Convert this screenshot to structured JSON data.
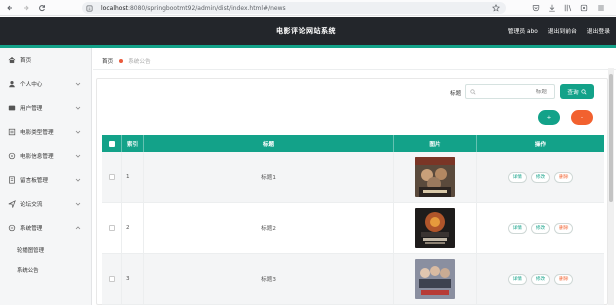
{
  "browser": {
    "url_host": "localhost",
    "url_path": ":8080/springbootmt92/admin/dist/index.html#/news"
  },
  "header": {
    "title": "电影评论网站系统",
    "user_label": "管理员 abo",
    "front_link": "退出到前台",
    "logout_link": "退出登录"
  },
  "sidebar": {
    "items": [
      {
        "label": "首页",
        "icon": "home-icon"
      },
      {
        "label": "个人中心",
        "icon": "user-icon"
      },
      {
        "label": "用户管理",
        "icon": "users-icon"
      },
      {
        "label": "电影类型管理",
        "icon": "category-icon"
      },
      {
        "label": "电影信息管理",
        "icon": "film-icon"
      },
      {
        "label": "留言板管理",
        "icon": "message-icon"
      },
      {
        "label": "论坛交流",
        "icon": "send-icon"
      },
      {
        "label": "系统管理",
        "icon": "settings-icon"
      }
    ],
    "sub_items": [
      "轮播图管理",
      "系统公告"
    ]
  },
  "breadcrumb": {
    "home": "首页",
    "current": "系统公告"
  },
  "search": {
    "label": "标题",
    "placeholder": "标题",
    "button": "查询"
  },
  "toolbar": {
    "add": "+",
    "delete": "-"
  },
  "table": {
    "headers": [
      "索引",
      "标题",
      "图片",
      "操作"
    ],
    "rows": [
      {
        "index": "1",
        "title": "标题1"
      },
      {
        "index": "2",
        "title": "标题2"
      },
      {
        "index": "3",
        "title": "标题3"
      }
    ],
    "actions": {
      "detail": "详情",
      "edit": "修改",
      "remove": "删除"
    }
  },
  "colors": {
    "accent": "#13a289",
    "danger": "#f2612f",
    "header_bg": "#23262b"
  }
}
